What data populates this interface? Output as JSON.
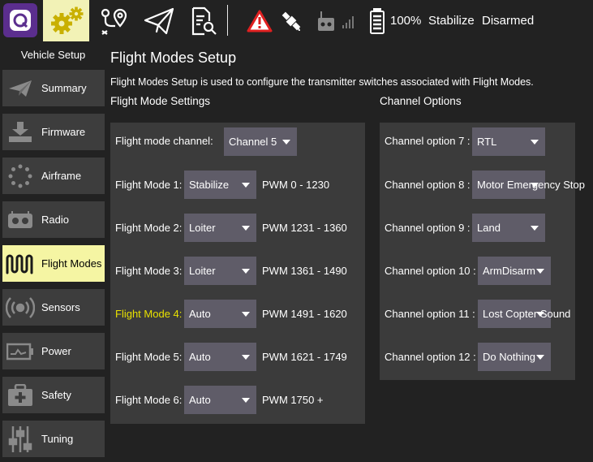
{
  "toolbar": {
    "battery_percent": "100%",
    "flight_mode": "Stabilize",
    "arm_state": "Disarmed",
    "icons": [
      "app-logo-icon",
      "settings-gears-icon",
      "plan-route-icon",
      "fly-paper-plane-icon",
      "analyze-document-icon",
      "warning-icon",
      "gps-satellite-icon",
      "rc-transmitter-icon",
      "signal-bars-icon",
      "battery-icon"
    ]
  },
  "sidebar": {
    "title": "Vehicle Setup",
    "items": [
      {
        "label": "Summary",
        "icon": "paper-plane-icon"
      },
      {
        "label": "Firmware",
        "icon": "download-icon"
      },
      {
        "label": "Airframe",
        "icon": "airframe-dots-icon"
      },
      {
        "label": "Radio",
        "icon": "radio-icon"
      },
      {
        "label": "Flight Modes",
        "icon": "wave-icon"
      },
      {
        "label": "Sensors",
        "icon": "sensors-icon"
      },
      {
        "label": "Power",
        "icon": "power-graph-icon"
      },
      {
        "label": "Safety",
        "icon": "safety-kit-icon"
      },
      {
        "label": "Tuning",
        "icon": "sliders-icon"
      }
    ],
    "active_item": "Flight Modes"
  },
  "main": {
    "title": "Flight Modes Setup",
    "description": "Flight Modes Setup is used to configure the transmitter switches associated with Flight Modes.",
    "flight_mode_settings": {
      "header": "Flight Mode Settings",
      "channel_label": "Flight mode channel:",
      "channel_value": "Channel 5",
      "modes": [
        {
          "label": "Flight Mode 1:",
          "value": "Stabilize",
          "pwm": "PWM 0 - 1230",
          "active": false
        },
        {
          "label": "Flight Mode 2:",
          "value": "Loiter",
          "pwm": "PWM 1231 - 1360",
          "active": false
        },
        {
          "label": "Flight Mode 3:",
          "value": "Loiter",
          "pwm": "PWM 1361 - 1490",
          "active": false
        },
        {
          "label": "Flight Mode 4:",
          "value": "Auto",
          "pwm": "PWM 1491 - 1620",
          "active": true
        },
        {
          "label": "Flight Mode 5:",
          "value": "Auto",
          "pwm": "PWM 1621 - 1749",
          "active": false
        },
        {
          "label": "Flight Mode 6:",
          "value": "Auto",
          "pwm": "PWM 1750 +",
          "active": false
        }
      ]
    },
    "channel_options": {
      "header": "Channel Options",
      "options": [
        {
          "label": "Channel option 7 :",
          "value": "RTL"
        },
        {
          "label": "Channel option 8 :",
          "value": "Motor Emergency Stop"
        },
        {
          "label": "Channel option 9 :",
          "value": "Land"
        },
        {
          "label": "Channel option 10 :",
          "value": "ArmDisarm"
        },
        {
          "label": "Channel option 11 :",
          "value": "Lost Copter Sound"
        },
        {
          "label": "Channel option 12 :",
          "value": "Do Nothing"
        }
      ]
    }
  },
  "colors": {
    "background": "#222222",
    "panel": "#3b3b3b",
    "sidebar_button": "#3d3d3d",
    "active_highlight": "#f5f5a3",
    "combo": "#5f5c68",
    "active_mode_text": "#e8e100",
    "logo": "#5b2e8e",
    "warning": "#e02020"
  }
}
